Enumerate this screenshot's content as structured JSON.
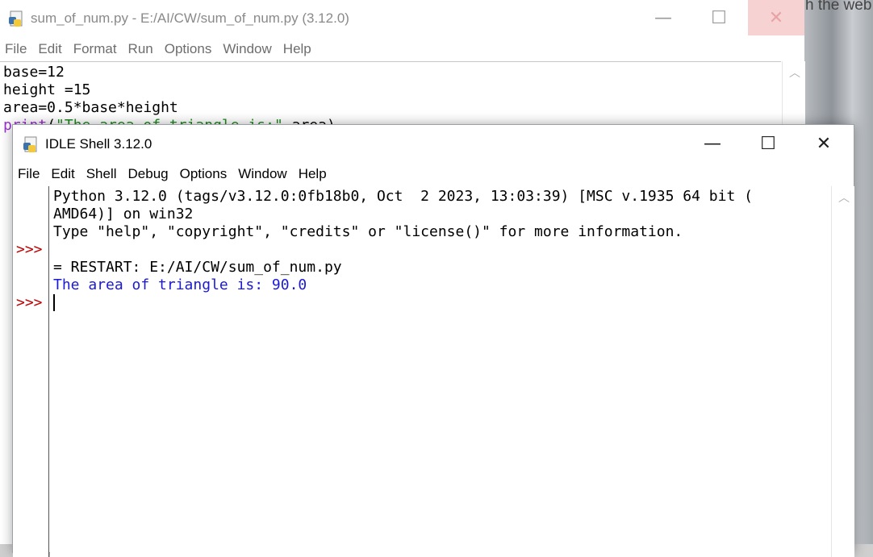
{
  "background": {
    "partial_text": "h the web"
  },
  "editor": {
    "title": "sum_of_num.py - E:/AI/CW/sum_of_num.py (3.12.0)",
    "menu": [
      "File",
      "Edit",
      "Format",
      "Run",
      "Options",
      "Window",
      "Help"
    ],
    "code_lines": [
      "base=12",
      "height =15",
      "area=0.5*base*height"
    ],
    "print_line": {
      "keyword": "print",
      "open": "(",
      "string": "\"The area of triangle is:\"",
      "rest": ",area)"
    },
    "buttons": {
      "minimize": "—",
      "maximize": "☐",
      "close": "✕"
    }
  },
  "shell": {
    "title": "IDLE Shell 3.12.0",
    "menu": [
      "File",
      "Edit",
      "Shell",
      "Debug",
      "Options",
      "Window",
      "Help"
    ],
    "buttons": {
      "minimize": "—",
      "maximize": "☐",
      "close": "✕"
    },
    "prompt": ">>>",
    "lines": [
      "Python 3.12.0 (tags/v3.12.0:0fb18b0, Oct  2 2023, 13:03:39) [MSC v.1935 64 bit (",
      "AMD64)] on win32",
      "Type \"help\", \"copyright\", \"credits\" or \"license()\" for more information.",
      "",
      "= RESTART: E:/AI/CW/sum_of_num.py",
      "The area of triangle is: 90.0"
    ],
    "colors": {
      "prompt": "#c00000",
      "output": "#1a1ad6"
    }
  }
}
